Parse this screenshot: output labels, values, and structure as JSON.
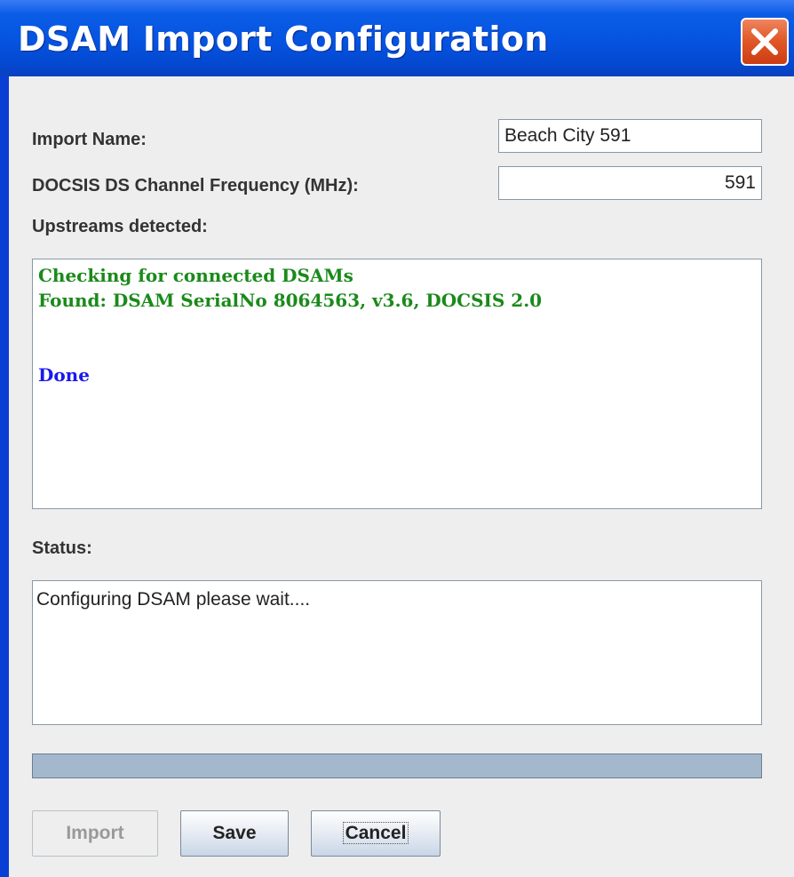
{
  "window": {
    "title": "DSAM Import Configuration",
    "close_icon": "close-icon"
  },
  "form": {
    "import_name_label": "Import Name:",
    "import_name_value": "Beach City 591",
    "frequency_label": "DOCSIS DS Channel Frequency (MHz):",
    "frequency_value": "591",
    "upstreams_label": "Upstreams detected:",
    "status_label": "Status:"
  },
  "log": {
    "lines": [
      {
        "text": "Checking for connected DSAMs",
        "color": "#1a8a1a"
      },
      {
        "text": "Found: DSAM SerialNo 8064563, v3.6, DOCSIS 2.0",
        "color": "#1a8a1a"
      },
      {
        "text": "Done",
        "color": "#1a1aee"
      }
    ]
  },
  "status": {
    "text": "Configuring DSAM please wait...."
  },
  "progress": {
    "value_percent": 0
  },
  "buttons": {
    "import_label": "Import",
    "save_label": "Save",
    "cancel_label": "Cancel"
  },
  "colors": {
    "title_bar": "#0553e0",
    "close_button": "#e25a2a",
    "log_found": "#1a8a1a",
    "log_done": "#1a1aee",
    "dialog_background": "#eeeeee"
  }
}
